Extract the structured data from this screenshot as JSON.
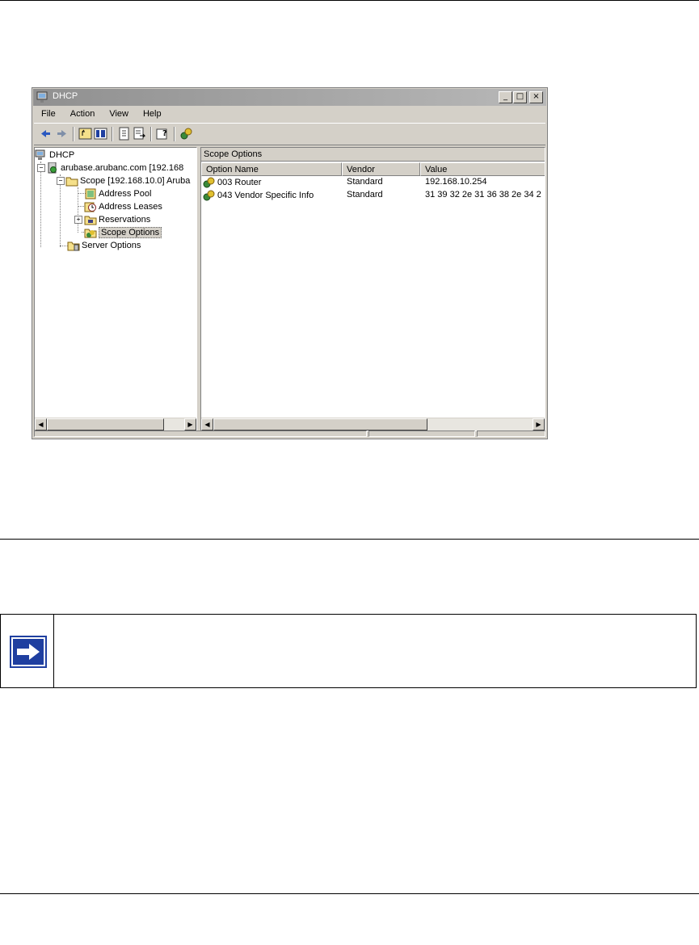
{
  "window": {
    "title": "DHCP",
    "controls": {
      "minimize": "_",
      "maximize": "□",
      "close": "×"
    }
  },
  "menubar": {
    "items": [
      {
        "label": "File"
      },
      {
        "label": "Action"
      },
      {
        "label": "View"
      },
      {
        "label": "Help"
      }
    ]
  },
  "toolbar": {
    "icons": [
      "back-arrow-icon",
      "forward-arrow-icon",
      "up-folder-icon",
      "show-hide-tree-icon",
      "properties-icon",
      "export-list-icon",
      "help-icon",
      "dhcp-options-icon"
    ]
  },
  "tree": {
    "root": "DHCP",
    "server": "arubase.arubanc.com [192.168",
    "scope": "Scope [192.168.10.0] Aruba",
    "scope_children": [
      "Address Pool",
      "Address Leases",
      "Reservations",
      "Scope Options"
    ],
    "selected": "Scope Options",
    "server_options": "Server Options"
  },
  "pane": {
    "header": "Scope Options",
    "columns": [
      "Option Name",
      "Vendor",
      "Value"
    ],
    "rows": [
      {
        "name": "003 Router",
        "vendor": "Standard",
        "value": "192.168.10.254"
      },
      {
        "name": "043 Vendor Specific Info",
        "vendor": "Standard",
        "value": "31 39 32 2e 31 36 38 2e 34 2"
      }
    ]
  },
  "colors": {
    "titlebar": "#909090",
    "chrome": "#d4d0c8",
    "note_icon": "#1f3fa0"
  }
}
